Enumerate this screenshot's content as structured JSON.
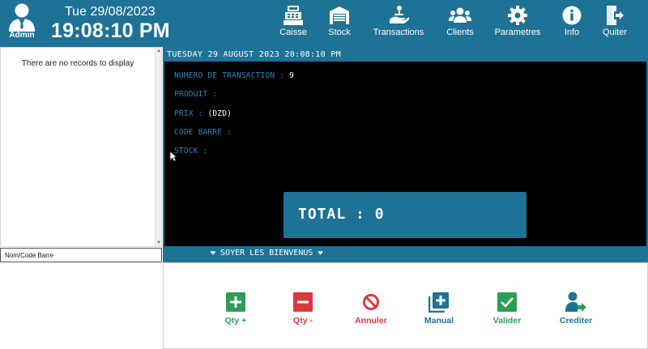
{
  "header": {
    "user_label": "Admin",
    "date": "Tue 29/08/2023",
    "time": "19:08:10 PM",
    "nav": [
      {
        "label": "Caisse",
        "icon": "cash-register-icon"
      },
      {
        "label": "Stock",
        "icon": "warehouse-icon"
      },
      {
        "label": "Transactions",
        "icon": "transactions-icon"
      },
      {
        "label": "Clients",
        "icon": "clients-icon"
      },
      {
        "label": "Parametres",
        "icon": "gear-icon"
      },
      {
        "label": "Info",
        "icon": "info-icon"
      },
      {
        "label": "Quiter",
        "icon": "exit-icon"
      }
    ]
  },
  "left": {
    "empty_message": "There are no records to display",
    "search_value": "Nom/Code Barre"
  },
  "display": {
    "header": "TUESDAY 29 AUGUST 2023 20:08:10 PM",
    "fields": [
      {
        "label": "NUMERO DE TRANSACTION : ",
        "value": "9"
      },
      {
        "label": "PRODUIT : ",
        "value": ""
      },
      {
        "label": "PRIX : ",
        "value": "(DZD)"
      },
      {
        "label": "CODE BARRE : ",
        "value": ""
      },
      {
        "label": "STOCK : ",
        "value": ""
      }
    ],
    "total": "TOTAL : 0",
    "footer": "❤ SOYER LES BIENVENUS ❤"
  },
  "actions": [
    {
      "label": "Qty +",
      "color": "#2e9e57",
      "icon": "plus-icon"
    },
    {
      "label": "Qty -",
      "color": "#d93a3a",
      "icon": "minus-icon"
    },
    {
      "label": "Annuler",
      "color": "#d93a3a",
      "icon": "cancel-icon"
    },
    {
      "label": "Manual",
      "color": "#1e7296",
      "icon": "manual-add-icon"
    },
    {
      "label": "Valider",
      "color": "#2e9e57",
      "icon": "check-icon"
    },
    {
      "label": "Crediter",
      "color": "#1e7296",
      "icon": "credit-user-icon"
    }
  ],
  "colors": {
    "accent": "#1e7296",
    "screen": "#000000",
    "field_text": "#2a86b8"
  }
}
